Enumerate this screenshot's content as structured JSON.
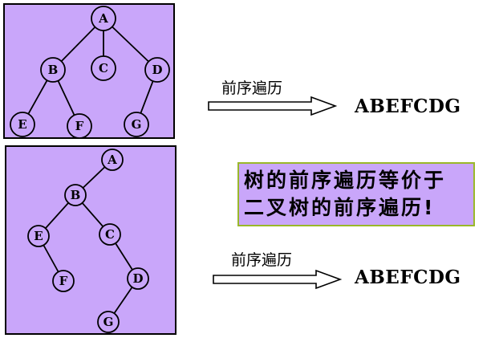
{
  "top_tree": {
    "nodes": {
      "A": "A",
      "B": "B",
      "C": "C",
      "D": "D",
      "E": "E",
      "F": "F",
      "G": "G"
    },
    "edges": [
      [
        "A",
        "B"
      ],
      [
        "A",
        "C"
      ],
      [
        "A",
        "D"
      ],
      [
        "B",
        "E"
      ],
      [
        "B",
        "F"
      ],
      [
        "D",
        "G"
      ]
    ]
  },
  "bottom_tree": {
    "nodes": {
      "A": "A",
      "B": "B",
      "C": "C",
      "D": "D",
      "E": "E",
      "F": "F",
      "G": "G"
    },
    "edges": [
      [
        "A",
        "B"
      ],
      [
        "B",
        "E"
      ],
      [
        "B",
        "C"
      ],
      [
        "E",
        "F"
      ],
      [
        "C",
        "D"
      ],
      [
        "D",
        "G"
      ]
    ]
  },
  "top_section": {
    "arrow_label": "前序遍历",
    "result": "ABEFCDG"
  },
  "bottom_section": {
    "arrow_label": "前序遍历",
    "result": "ABEFCDG"
  },
  "callout": {
    "line1": "树的前序遍历等价于",
    "line2": "二叉树的前序遍历!"
  },
  "colors": {
    "panel_fill": "#c9a6fa",
    "callout_border": "#9ab82a"
  }
}
